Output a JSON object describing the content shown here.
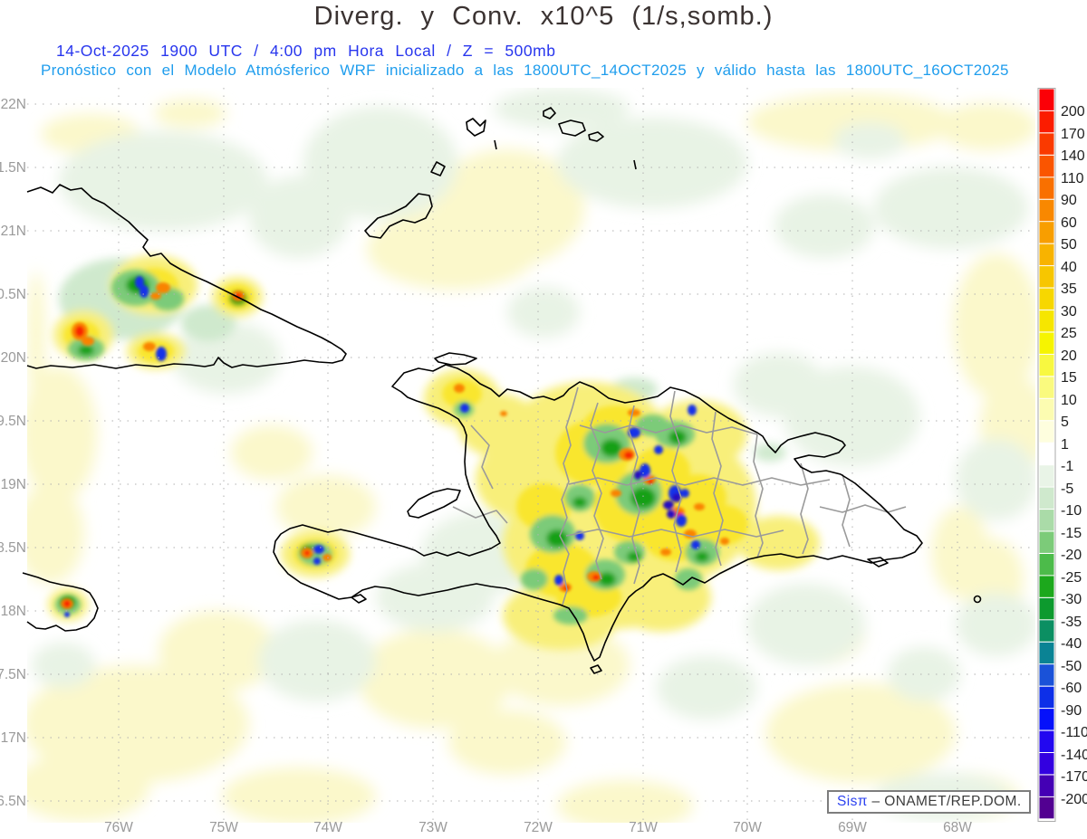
{
  "title": "Diverg. y Conv. x10^5 (1/s,somb.)",
  "date_line": "14-Oct-2025   1900 UTC / 4:00 pm Hora Local / Z = 500mb",
  "model_line": "Pronóstico con el Modelo Atmósferico WRF inicializado a las 1800UTC_14OCT2025 y válido hasta las  1800UTC_16OCT2025",
  "axes": {
    "lat": [
      "22N",
      "1.5N",
      "21N",
      "0.5N",
      "20N",
      "9.5N",
      "19N",
      "8.5N",
      "18N",
      "7.5N",
      "17N",
      "6.5N"
    ],
    "lon": [
      "76W",
      "75W",
      "74W",
      "73W",
      "72W",
      "71W",
      "70W",
      "69W",
      "68W"
    ]
  },
  "colorbar": {
    "labels": [
      "200",
      "170",
      "140",
      "110",
      "90",
      "60",
      "50",
      "40",
      "35",
      "30",
      "25",
      "20",
      "15",
      "10",
      "5",
      "1",
      "-1",
      "-5",
      "-10",
      "-15",
      "-20",
      "-25",
      "-30",
      "-35",
      "-40",
      "-50",
      "-60",
      "-90",
      "-110",
      "-140",
      "-170",
      "-200"
    ],
    "colors": [
      "#fb0007",
      "#fb1c00",
      "#fa3a00",
      "#fa5500",
      "#f97000",
      "#f98800",
      "#f89e00",
      "#f8b300",
      "#f7c600",
      "#f7d700",
      "#f6e600",
      "#f6f400",
      "#f8f840",
      "#fafa7e",
      "#fcfcb1",
      "#fefede",
      "#ffffff",
      "#e9f4e7",
      "#cfe9cd",
      "#aadba8",
      "#7ccb79",
      "#4cbb4a",
      "#1ca81c",
      "#0d9a2e",
      "#0b8f62",
      "#0a8394",
      "#1a52d8",
      "#0d2fe8",
      "#0511fa",
      "#2208f0",
      "#3300e0",
      "#4400b4",
      "#520091"
    ]
  },
  "credit": {
    "logo": "Sisπ",
    "text": "– ONAMET/REP.DOM."
  },
  "colors": {
    "title_text": "#3b3332",
    "date_text": "#2836ee",
    "model_text": "#1f9ded",
    "axis_text": "#9a9a9a",
    "coastline": "#000000",
    "admin_border": "#9a9a9a",
    "grid": "#b0b0b0"
  }
}
